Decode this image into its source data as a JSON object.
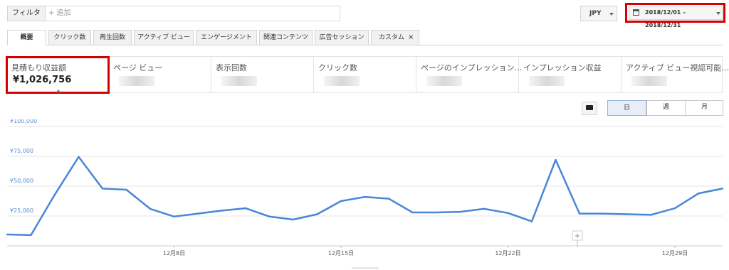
{
  "filter": {
    "label": "フィルタ",
    "placeholder": "+ 追加"
  },
  "currency": {
    "value": "JPY"
  },
  "date_range": {
    "value": "2018/12/01 – 2018/12/31"
  },
  "tabs": [
    {
      "label": "概要",
      "active": true
    },
    {
      "label": "クリック数"
    },
    {
      "label": "再生回数"
    },
    {
      "label": "アクティブ ビュー"
    },
    {
      "label": "エンゲージメント"
    },
    {
      "label": "関連コンテンツ"
    },
    {
      "label": "広告セッション"
    },
    {
      "label": "カスタム",
      "close": "×"
    }
  ],
  "metrics": [
    {
      "label": "見積もり収益額",
      "value": "¥1,026,756",
      "selected": true
    },
    {
      "label": "ページ ビュー"
    },
    {
      "label": "表示回数"
    },
    {
      "label": "クリック数"
    },
    {
      "label": "ページのインプレッション…"
    },
    {
      "label": "インプレッション収益"
    },
    {
      "label": "アクティブ ビュー視認可能…"
    }
  ],
  "period_buttons": [
    {
      "label": "日",
      "active": true
    },
    {
      "label": "週"
    },
    {
      "label": "月"
    }
  ],
  "icons": {
    "calendar": "calendar-icon",
    "annotation": "comment-icon",
    "dropdown": "caret-down-icon",
    "close": "close-icon",
    "add_annotation": "plus-icon"
  },
  "colors": {
    "line": "#4a86d6",
    "highlight": "#d40000",
    "axis_text": "#5b8fd6"
  },
  "chart_data": {
    "type": "line",
    "x": [
      "12/1",
      "12/2",
      "12/3",
      "12/4",
      "12/5",
      "12/6",
      "12/7",
      "12/8",
      "12/9",
      "12/10",
      "12/11",
      "12/12",
      "12/13",
      "12/14",
      "12/15",
      "12/16",
      "12/17",
      "12/18",
      "12/19",
      "12/20",
      "12/21",
      "12/22",
      "12/23",
      "12/24",
      "12/25",
      "12/26",
      "12/27",
      "12/28",
      "12/29",
      "12/30",
      "12/31"
    ],
    "series": [
      {
        "values": [
          9500,
          9000,
          43000,
          74500,
          48000,
          47000,
          31000,
          24500,
          27000,
          29500,
          31500,
          24500,
          22000,
          26500,
          37500,
          41000,
          39500,
          28000,
          28000,
          28500,
          31000,
          27500,
          20500,
          72000,
          27000,
          27000,
          26500,
          26000,
          31500,
          44000,
          48000
        ]
      }
    ],
    "yticks": [
      "¥100,000",
      "¥75,000",
      "¥50,000",
      "¥25,000"
    ],
    "ytick_values": [
      100000,
      75000,
      50000,
      25000
    ],
    "xticks": [
      {
        "label": "12月8日",
        "index": 7
      },
      {
        "label": "12月15日",
        "index": 14
      },
      {
        "label": "12月22日",
        "index": 21
      },
      {
        "label": "12月29日",
        "index": 28
      }
    ],
    "ylim": [
      0,
      100000
    ],
    "grid": true
  }
}
